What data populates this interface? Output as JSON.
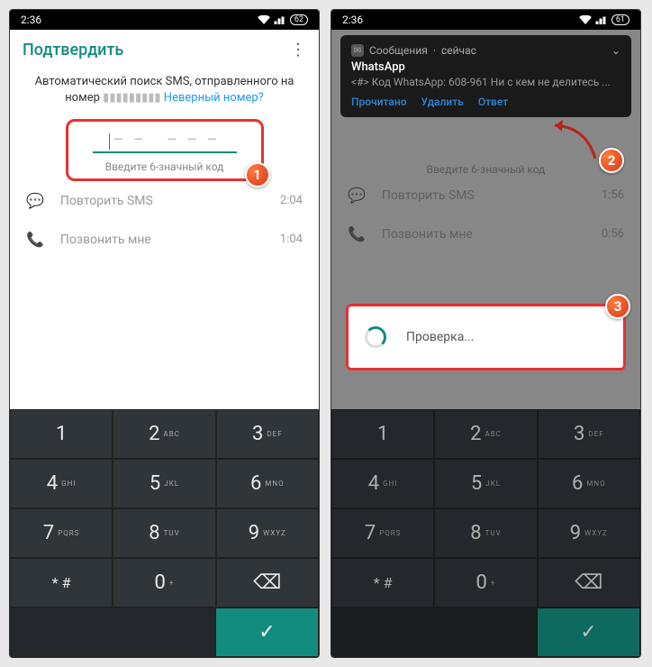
{
  "status": {
    "time": "2:36",
    "battery": "62",
    "battery2": "61"
  },
  "left": {
    "title": "Подтвердить",
    "info1": "Автоматический поиск SMS, отправленного на",
    "info2": "номер",
    "wrong": "Неверный номер?",
    "hint": "Введите 6-значный код",
    "resend": "Повторить SMS",
    "resend_time": "2:04",
    "call": "Позвонить мне",
    "call_time": "1:04"
  },
  "right": {
    "notif_app": "Сообщения",
    "notif_now": "сейчас",
    "notif_title": "WhatsApp",
    "notif_body": "<#> Код WhatsApp: 608-961 Ни с кем не делитесь ...",
    "act_read": "Прочитано",
    "act_delete": "Удалить",
    "act_reply": "Ответ",
    "hint": "Введите 6-значный код",
    "resend": "Повторить SMS",
    "resend_time": "1:56",
    "call": "Позвонить мне",
    "call_time": "0:56",
    "verify": "Проверка..."
  },
  "badges": {
    "b1": "1",
    "b2": "2",
    "b3": "3"
  },
  "kp": {
    "k1": "1",
    "k2": "2",
    "k3": "3",
    "k4": "4",
    "k5": "5",
    "k6": "6",
    "k7": "7",
    "k8": "8",
    "k9": "9",
    "k0": "0",
    "s2": "ABC",
    "s3": "DEF",
    "s4": "GHI",
    "s5": "JKL",
    "s6": "MNO",
    "s7": "PQRS",
    "s8": "TUV",
    "s9": "WXYZ",
    "s0": "+",
    "sym": "* #",
    "confirm": "✓",
    "back": "⌫"
  }
}
